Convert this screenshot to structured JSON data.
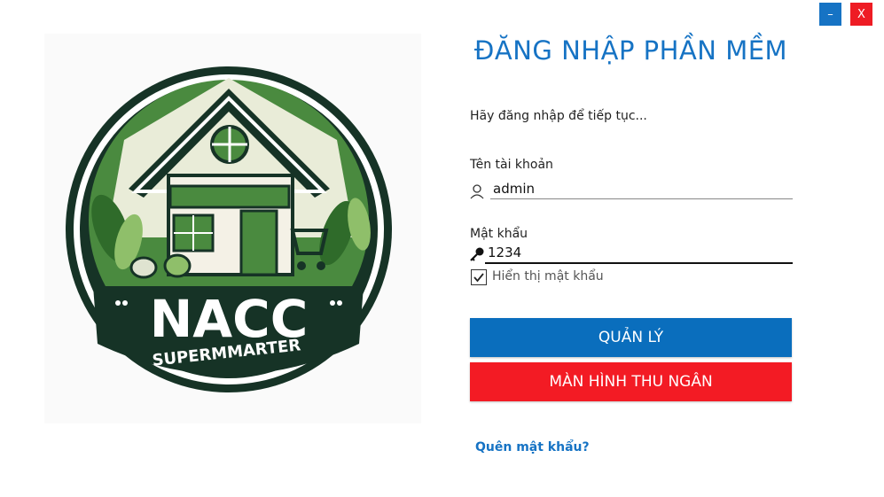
{
  "window": {
    "minimize_label": "–",
    "close_label": "X"
  },
  "logo": {
    "brand": "NACC",
    "tagline": "SUPERMMARTER",
    "colors": {
      "dark": "#163326",
      "green": "#4a8a3f",
      "light_green": "#8fbf6a"
    }
  },
  "login": {
    "title": "ĐĂNG NHẬP PHẦN MỀM",
    "subtitle": "Hãy đăng nhập để tiếp tục...",
    "username_label": "Tên tài khoản",
    "username_value": "admin",
    "password_label": "Mật khẩu",
    "password_value": "1234",
    "show_password_label": "Hiển thị mật khẩu",
    "show_password_checked": true,
    "admin_button": "QUẢN LÝ",
    "cashier_button": "MÀN HÌNH THU NGÂN",
    "forgot_link": "Quên mật khẩu?"
  },
  "colors": {
    "accent": "#1673c4",
    "danger": "#f31b24"
  },
  "icons": {
    "user": "user-icon",
    "key": "key-icon",
    "check": "check-icon"
  }
}
